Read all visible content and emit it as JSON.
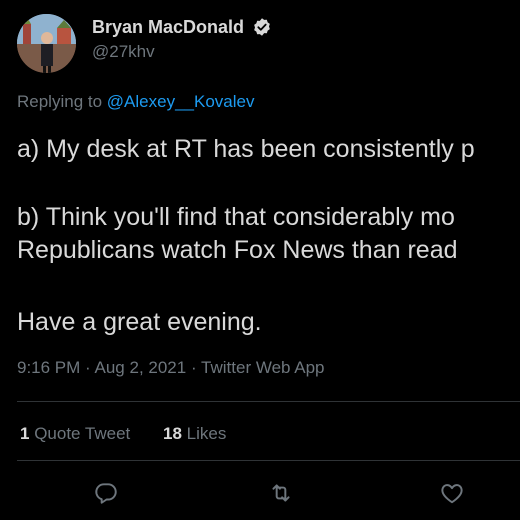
{
  "author": {
    "name": "Bryan MacDonald",
    "handle": "@27khv",
    "verified": true,
    "avatar_icon": "profile-photo"
  },
  "reply": {
    "prefix": "Replying to",
    "mention": "@Alexey__Kovalev"
  },
  "tweet": {
    "lines": [
      "a) My desk at RT has been consistently p",
      "b) Think you'll find that considerably mo",
      "Republicans watch Fox News than read",
      "Have a great evening."
    ]
  },
  "meta": {
    "time": "9:16 PM",
    "separator": "·",
    "date": "Aug 2, 2021",
    "source": "Twitter Web App"
  },
  "stats": {
    "quote_count": "1",
    "quote_label": "Quote Tweet",
    "like_count": "18",
    "like_label": "Likes"
  },
  "actions": {
    "reply_icon": "reply-icon",
    "retweet_icon": "retweet-icon",
    "like_icon": "like-icon"
  },
  "colors": {
    "background": "#000000",
    "text": "#d9d9d9",
    "secondary": "#6e767d",
    "link": "#1d9bf0",
    "divider": "#2f3336"
  }
}
